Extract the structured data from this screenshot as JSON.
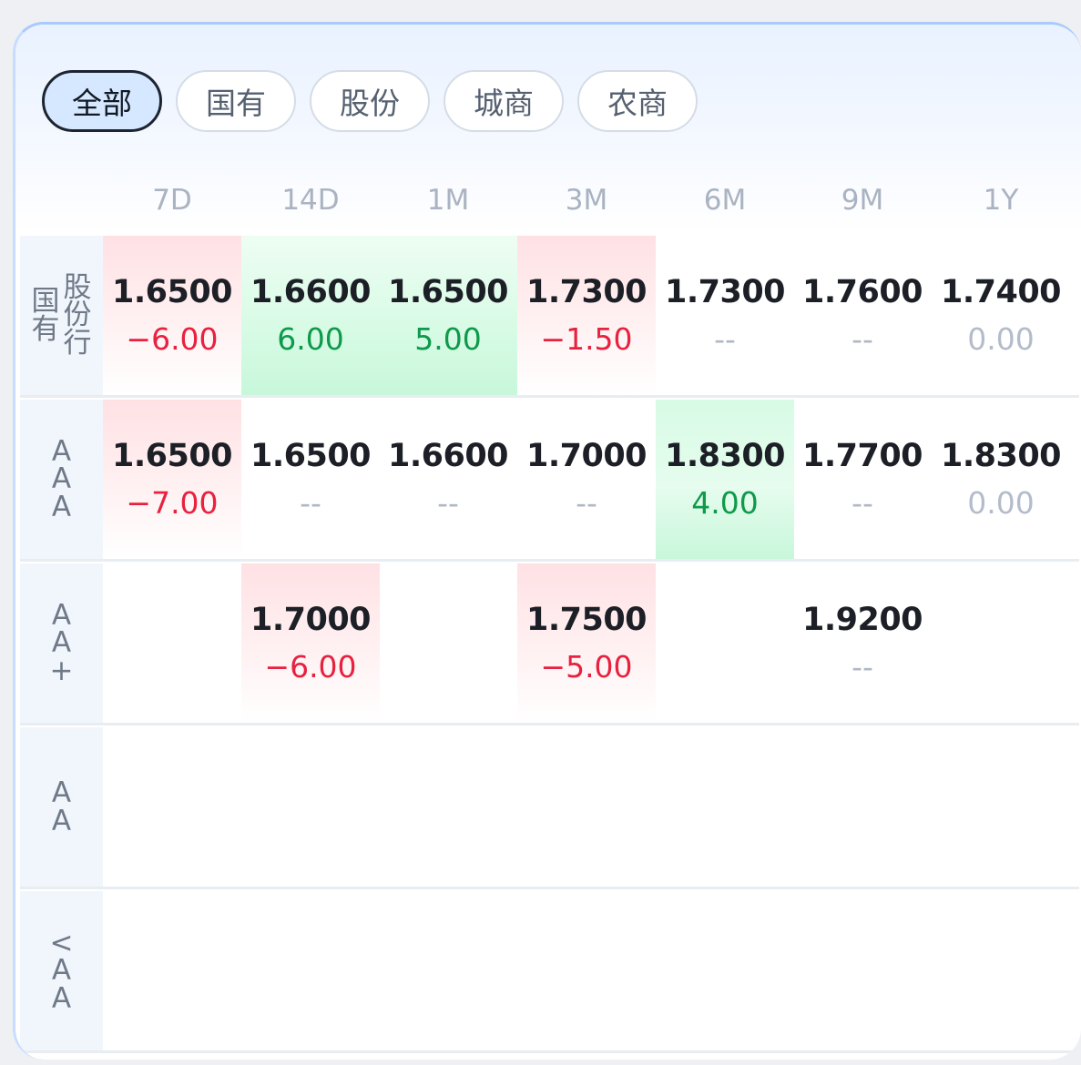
{
  "tabs": [
    {
      "label": "全部",
      "active": true
    },
    {
      "label": "国有",
      "active": false
    },
    {
      "label": "股份",
      "active": false
    },
    {
      "label": "城商",
      "active": false
    },
    {
      "label": "农商",
      "active": false
    }
  ],
  "columns": [
    "7D",
    "14D",
    "1M",
    "3M",
    "6M",
    "9M",
    "1Y"
  ],
  "rows": [
    {
      "label_main": "国有",
      "label_side": "股份行",
      "cells": [
        {
          "price": "1.6500",
          "change": "−6.00",
          "trend": "up"
        },
        {
          "price": "1.6600",
          "change": "6.00",
          "trend": "down"
        },
        {
          "price": "1.6500",
          "change": "5.00",
          "trend": "down"
        },
        {
          "price": "1.7300",
          "change": "−1.50",
          "trend": "up"
        },
        {
          "price": "1.7300",
          "change": "--",
          "trend": "none"
        },
        {
          "price": "1.7600",
          "change": "--",
          "trend": "none"
        },
        {
          "price": "1.7400",
          "change": "0.00",
          "trend": "flat"
        }
      ]
    },
    {
      "label_main": "AAA",
      "cells": [
        {
          "price": "1.6500",
          "change": "−7.00",
          "trend": "up"
        },
        {
          "price": "1.6500",
          "change": "--",
          "trend": "none"
        },
        {
          "price": "1.6600",
          "change": "--",
          "trend": "none"
        },
        {
          "price": "1.7000",
          "change": "--",
          "trend": "none"
        },
        {
          "price": "1.8300",
          "change": "4.00",
          "trend": "down"
        },
        {
          "price": "1.7700",
          "change": "--",
          "trend": "none"
        },
        {
          "price": "1.8300",
          "change": "0.00",
          "trend": "flat"
        }
      ]
    },
    {
      "label_main": "AA+",
      "cells": [
        null,
        {
          "price": "1.7000",
          "change": "−6.00",
          "trend": "up"
        },
        null,
        {
          "price": "1.7500",
          "change": "−5.00",
          "trend": "up"
        },
        null,
        {
          "price": "1.9200",
          "change": "--",
          "trend": "none"
        },
        null
      ]
    },
    {
      "label_main": "AA",
      "cells": [
        null,
        null,
        null,
        null,
        null,
        null,
        null
      ]
    },
    {
      "label_main": "<AA",
      "cells": [
        null,
        null,
        null,
        null,
        null,
        null,
        null
      ]
    }
  ]
}
